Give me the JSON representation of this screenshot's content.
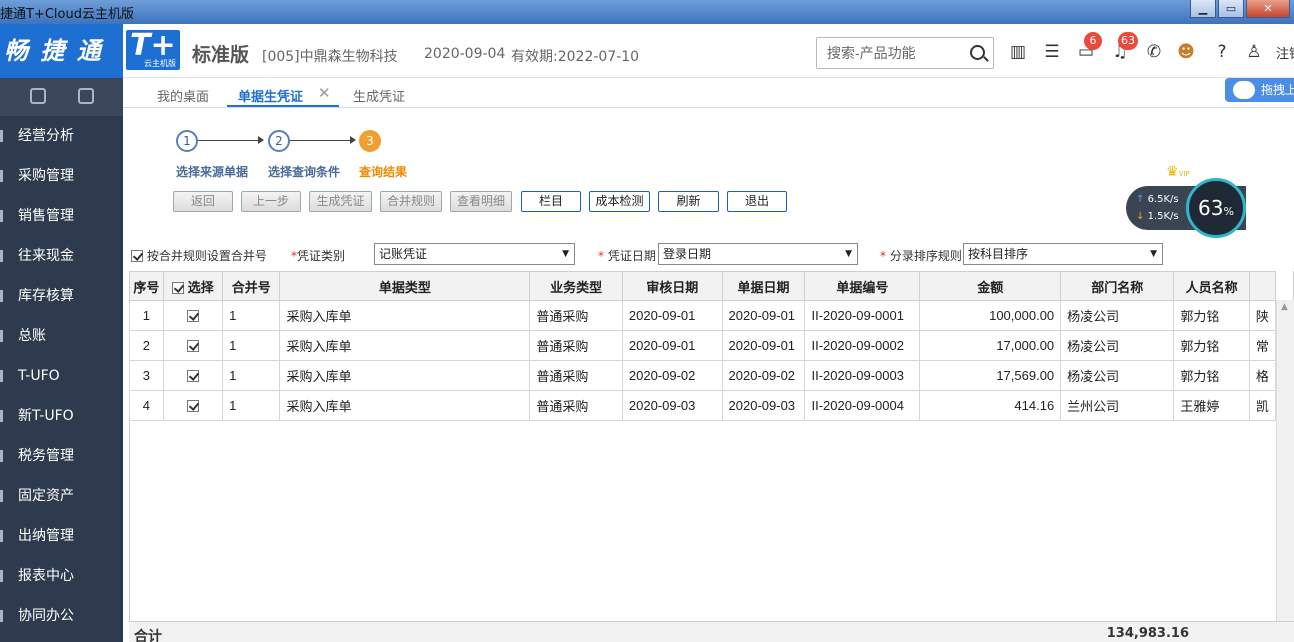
{
  "window": {
    "title": "捷通T+Cloud云主机版",
    "min": "▁",
    "max": "▭",
    "close": "✕"
  },
  "header": {
    "brand": "畅 捷 通",
    "logo_text": "T+",
    "logo_sub": "云主机版",
    "edition": "标准版",
    "company": "[005]中鼎森生物科技",
    "date": "2020-09-04",
    "validity": "有效期:2022-07-10",
    "search_placeholder": "搜索-产品功能",
    "msg_badge": "6",
    "notice_badge": "63",
    "user": "注销"
  },
  "sidebar": {
    "items": [
      "经营分析",
      "采购管理",
      "销售管理",
      "往来现金",
      "库存核算",
      "总账",
      "T-UFO",
      "新T-UFO",
      "税务管理",
      "固定资产",
      "出纳管理",
      "报表中心",
      "协同办公"
    ]
  },
  "tabs": [
    {
      "label": "我的桌面"
    },
    {
      "label": "单据生凭证"
    },
    {
      "label": "生成凭证"
    }
  ],
  "baidu_label": "拖拽上传",
  "steps": [
    {
      "num": "1",
      "label": "选择来源单据"
    },
    {
      "num": "2",
      "label": "选择查询条件"
    },
    {
      "num": "3",
      "label": "查询结果"
    }
  ],
  "toolbar": [
    "返回",
    "上一步",
    "生成凭证",
    "合并规则",
    "查看明细",
    "栏目",
    "成本检测",
    "刷新",
    "退出"
  ],
  "speed": {
    "up": "6.5K/s",
    "down": "1.5K/s",
    "percent": "63",
    "unit": "%",
    "vip": "VIP"
  },
  "options": {
    "merge_label": "按合并规则设置合并号",
    "voucher_type_label": "凭证类别",
    "voucher_type_value": "记账凭证",
    "voucher_date_label": "凭证日期",
    "voucher_date_value": "登录日期",
    "sort_label": "分录排序规则",
    "sort_value": "按科目排序"
  },
  "table": {
    "columns": [
      "序号",
      "选择",
      "合并号",
      "单据类型",
      "业务类型",
      "审核日期",
      "单据日期",
      "单据编号",
      "金额",
      "部门名称",
      "人员名称"
    ],
    "rows": [
      {
        "seq": "1",
        "merge": "1",
        "doc_type": "采购入库单",
        "biz_type": "普通采购",
        "audit_date": "2020-09-01",
        "doc_date": "2020-09-01",
        "doc_no": "II-2020-09-0001",
        "amount": "100,000.00",
        "dept": "杨凌公司",
        "person": "郭力铭",
        "extra": "陕"
      },
      {
        "seq": "2",
        "merge": "1",
        "doc_type": "采购入库单",
        "biz_type": "普通采购",
        "audit_date": "2020-09-01",
        "doc_date": "2020-09-01",
        "doc_no": "II-2020-09-0002",
        "amount": "17,000.00",
        "dept": "杨凌公司",
        "person": "郭力铭",
        "extra": "常"
      },
      {
        "seq": "3",
        "merge": "1",
        "doc_type": "采购入库单",
        "biz_type": "普通采购",
        "audit_date": "2020-09-02",
        "doc_date": "2020-09-02",
        "doc_no": "II-2020-09-0003",
        "amount": "17,569.00",
        "dept": "杨凌公司",
        "person": "郭力铭",
        "extra": "格"
      },
      {
        "seq": "4",
        "merge": "1",
        "doc_type": "采购入库单",
        "biz_type": "普通采购",
        "audit_date": "2020-09-03",
        "doc_date": "2020-09-03",
        "doc_no": "II-2020-09-0004",
        "amount": "414.16",
        "dept": "兰州公司",
        "person": "王雅婷",
        "extra": "凯"
      }
    ],
    "total_label": "合计",
    "total_amount": "134,983.16"
  }
}
